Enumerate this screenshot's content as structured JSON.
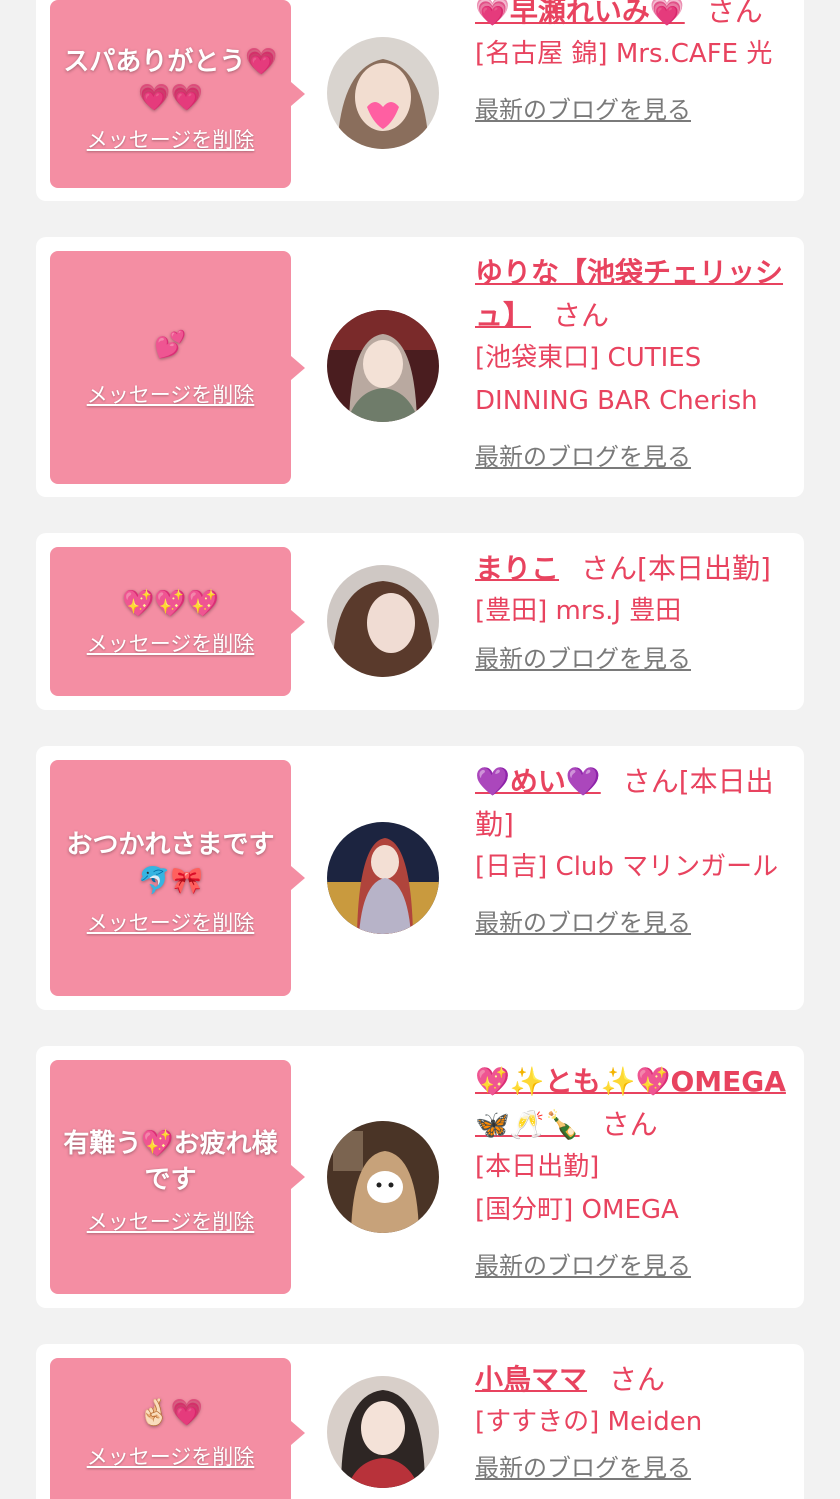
{
  "colors": {
    "accent": "#e8435f",
    "bubble": "#f48ea3",
    "background": "#f2f2f2",
    "card": "#ffffff",
    "link_gray": "#7a7a7a"
  },
  "cards": [
    {
      "message": "スパありがとう💗\n💗💗",
      "delete_label": "メッセージを削除",
      "name": "💗早瀬れいみ💗",
      "honorific": "さん",
      "status": "",
      "shop": "[名古屋 錦] Mrs.CAFE 光",
      "blog_label": "最新のブログを見る"
    },
    {
      "message": "💕",
      "delete_label": "メッセージを削除",
      "name": "ゆりな【池袋チェリッシュ】",
      "honorific": "さん",
      "status": "",
      "shop": "[池袋東口] CUTIES DINNING BAR Cherish",
      "blog_label": "最新のブログを見る"
    },
    {
      "message": "💖💖💖",
      "delete_label": "メッセージを削除",
      "name": "まりこ",
      "honorific": "さん",
      "status": "[本日出勤]",
      "shop": "[豊田] mrs.J 豊田",
      "blog_label": "最新のブログを見る"
    },
    {
      "message": "おつかれさまです\n🐬🎀",
      "delete_label": "メッセージを削除",
      "name": "💜めい💜",
      "honorific": "さん",
      "status": "[本日出勤]",
      "shop": "[日吉] Club マリンガール",
      "blog_label": "最新のブログを見る"
    },
    {
      "message": "有難う💖お疲れ様\nです",
      "delete_label": "メッセージを削除",
      "name": "💖✨とも✨💖OMEGA🦋🥂🍾",
      "honorific": "さん",
      "status": "[本日出勤]",
      "shop": "[国分町] OMEGA",
      "blog_label": "最新のブログを見る"
    },
    {
      "message": "🤞🏻💗",
      "delete_label": "メッセージを削除",
      "name": "小鳥ママ",
      "honorific": "さん",
      "status": "",
      "shop": "[すすきの] Meiden",
      "blog_label": "最新のブログを見る"
    }
  ]
}
